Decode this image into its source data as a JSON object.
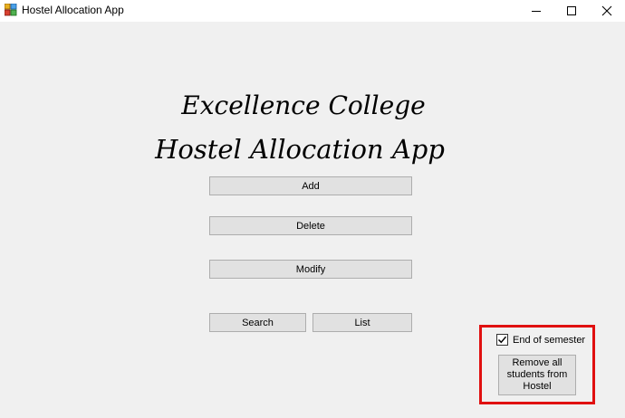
{
  "window": {
    "title": "Hostel Allocation App",
    "icon": "app-window-icon",
    "controls": [
      "minimize-icon",
      "maximize-icon",
      "close-icon"
    ]
  },
  "main": {
    "heading_line1": "Excellence College",
    "heading_line2": "Hostel Allocation App",
    "buttons": {
      "add": "Add",
      "delete": "Delete",
      "modify": "Modify",
      "search": "Search",
      "list": "List"
    }
  },
  "semester_panel": {
    "checkbox_label": "End of semester",
    "checkbox_checked": true,
    "remove_button": "Remove all students from Hostel",
    "highlight_color": "#e01010"
  }
}
